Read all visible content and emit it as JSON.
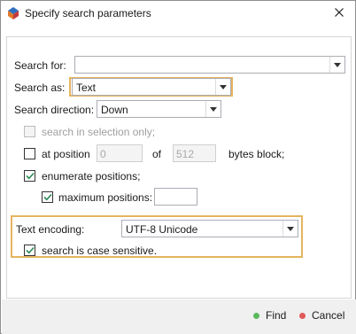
{
  "window": {
    "title": "Specify search parameters",
    "app_icon": "app-logo-icon",
    "close_icon": "close-icon"
  },
  "search_for": {
    "label": "Search for:",
    "value": ""
  },
  "search_as": {
    "label": "Search as:",
    "value": "Text"
  },
  "search_direction": {
    "label": "Search direction:",
    "value": "Down"
  },
  "search_in_selection": {
    "label": "search in selection only;",
    "checked": false,
    "enabled": false
  },
  "at_position": {
    "label": "at position",
    "position_value": "0",
    "of_label": "of",
    "block_value": "512",
    "suffix_label": "bytes block;",
    "checked": false
  },
  "enumerate_positions": {
    "label": "enumerate positions;",
    "checked": true
  },
  "maximum_positions": {
    "label": "maximum positions:",
    "value": "",
    "checked": true
  },
  "text_encoding": {
    "label": "Text encoding:",
    "value": "UTF-8 Unicode"
  },
  "case_sensitive": {
    "label": "search is case sensitive.",
    "checked": true
  },
  "buttons": {
    "find": "Find",
    "cancel": "Cancel"
  },
  "colors": {
    "find_dot": "#5cb85c",
    "cancel_dot": "#e05a5a",
    "highlight": "#e6b45e",
    "check": "#2e8b57"
  }
}
